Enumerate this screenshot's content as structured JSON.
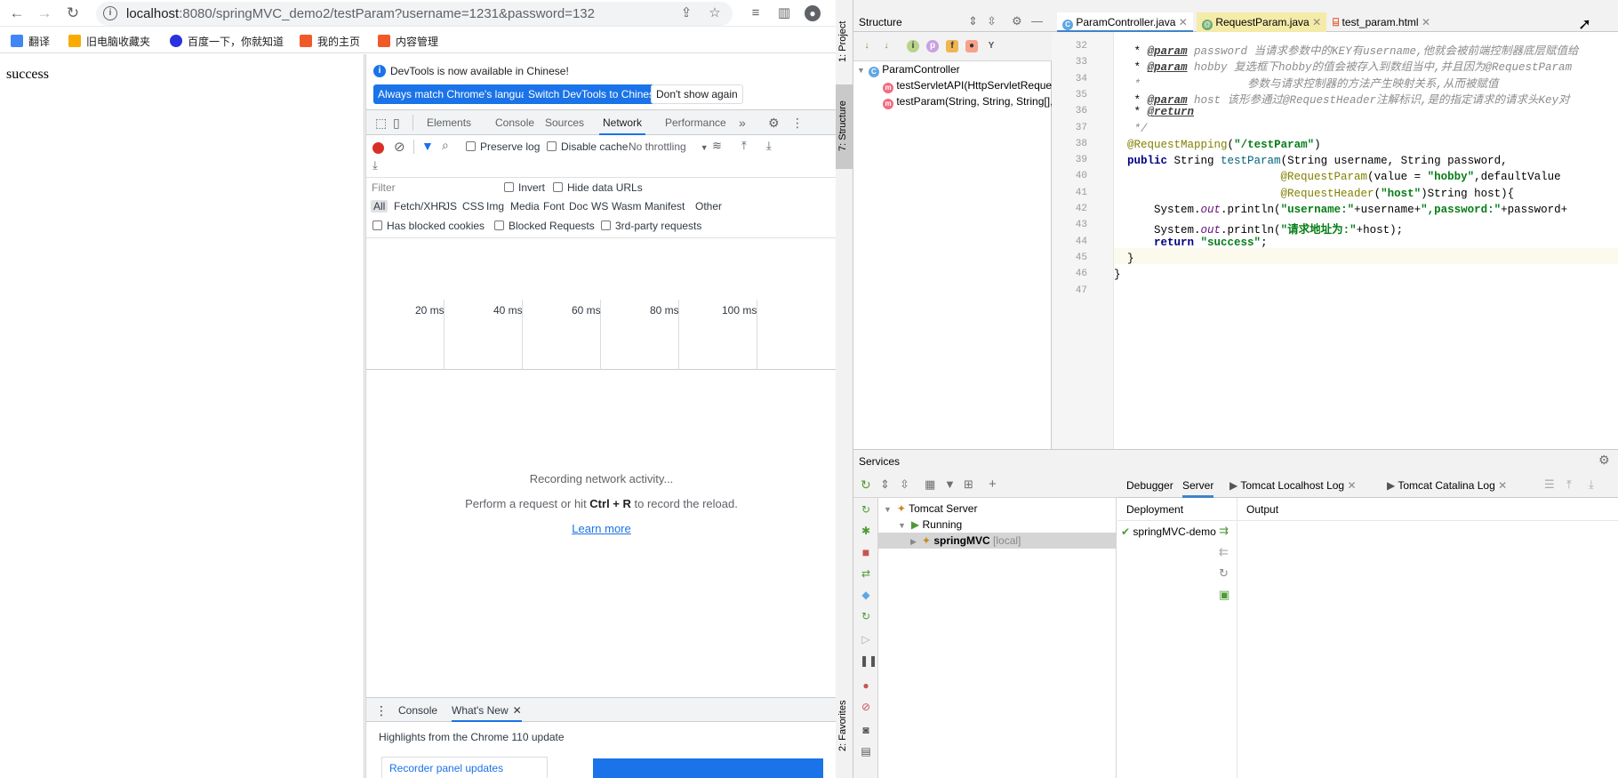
{
  "browser": {
    "url_host": "localhost",
    "url_rest": ":8080/springMVC_demo2/testParam?username=1231&password=132",
    "bookmarks": [
      "翻译",
      "旧电脑收藏夹",
      "百度一下，你就知道",
      "我的主页",
      "内容管理"
    ],
    "page_text": "success"
  },
  "devtools": {
    "banner_text": "DevTools is now available in Chinese!",
    "btn_match": "Always match Chrome's language",
    "btn_switch": "Switch DevTools to Chinese",
    "btn_dont": "Don't show again",
    "tabs": [
      "Elements",
      "Console",
      "Sources",
      "Network",
      "Performance"
    ],
    "preserve_log": "Preserve log",
    "disable_cache": "Disable cache",
    "throttling": "No throttling",
    "filter_placeholder": "Filter",
    "invert": "Invert",
    "hide_data_urls": "Hide data URLs",
    "types": [
      "All",
      "Fetch/XHR",
      "JS",
      "CSS",
      "Img",
      "Media",
      "Font",
      "Doc",
      "WS",
      "Wasm",
      "Manifest",
      "Other"
    ],
    "has_blocked_cookies": "Has blocked cookies",
    "blocked_requests": "Blocked Requests",
    "third_party": "3rd-party requests",
    "timeline": [
      "20 ms",
      "40 ms",
      "60 ms",
      "80 ms",
      "100 ms"
    ],
    "recording": "Recording network activity...",
    "perform_prefix": "Perform a request or hit ",
    "perform_key": "Ctrl + R",
    "perform_suffix": " to record the reload.",
    "learn_more": "Learn more",
    "drawer_tabs": [
      "Console",
      "What's New"
    ],
    "highlights": "Highlights from the Chrome 110 update",
    "recorder": "Recorder panel updates"
  },
  "ide": {
    "left_strip": [
      "1: Project",
      "7: Structure",
      "2: Favorites"
    ],
    "structure_title": "Structure",
    "tree": {
      "class": "ParamController",
      "m1": "testServletAPI(HttpServletRequest)",
      "m2": "testParam(String, String, String[], String)"
    },
    "tabs": [
      "ParamController.java",
      "RequestParam.java",
      "test_param.html"
    ],
    "code": [
      {
        "n": "32",
        "html": "   * <span class='c-tag'>@param</span><span class='c-doc'> password 当请求参数中的KEY有username,他就会被前端控制器底层赋值给</span>"
      },
      {
        "n": "33",
        "html": "   * <span class='c-tag'>@param</span><span class='c-doc'> hobby 复选框下hobby的值会被存入到数组当中,并且因为@RequestParam</span>"
      },
      {
        "n": "34",
        "html": "<span class='c-doc'>   *                参数与请求控制器的方法产生映射关系,从而被赋值</span>"
      },
      {
        "n": "35",
        "html": "   * <span class='c-tag'>@param</span><span class='c-doc'> host 该形参通过@RequestHeader注解标识,是的指定请求的请求头Key对</span>"
      },
      {
        "n": "36",
        "html": "   * <span class='c-tag'>@return</span>"
      },
      {
        "n": "37",
        "html": "<span class='c-doc'>   */</span>"
      },
      {
        "n": "38",
        "html": "  <span class='c-ann'>@RequestMapping</span>(<span class='c-str'>\"/testParam\"</span>)"
      },
      {
        "n": "39",
        "html": "  <span class='c-kw'>public</span> String <span class='c-fn'>testParam</span>(String username, String password,"
      },
      {
        "n": "40",
        "html": "                         <span class='c-ann'>@RequestParam</span>(value = <span class='c-str'>\"hobby\"</span>,defaultValue"
      },
      {
        "n": "41",
        "html": "                         <span class='c-ann'>@RequestHeader</span>(<span class='c-str'>\"host\"</span>)String host){"
      },
      {
        "n": "42",
        "html": "      System.<span class='c-static'>out</span>.println(<span class='c-str'>\"username:\"</span>+username+<span class='c-str'>\",password:\"</span>+password+"
      },
      {
        "n": "43",
        "html": "      System.<span class='c-static'>out</span>.println(<span class='c-str'>\"请求地址为:\"</span>+host);"
      },
      {
        "n": "44",
        "html": "      <span class='c-kw'>return</span> <span class='c-str'>\"success\"</span>;"
      },
      {
        "n": "45",
        "html": "  }"
      },
      {
        "n": "46",
        "html": "}"
      },
      {
        "n": "47",
        "html": ""
      }
    ],
    "services_title": "Services",
    "svc_tabs": [
      "Debugger",
      "Server",
      "Tomcat Localhost Log",
      "Tomcat Catalina Log"
    ],
    "svc_tree": {
      "server": "Tomcat Server",
      "running": "Running",
      "app": "springMVC",
      "app_suffix": "[local]"
    },
    "deployment_label": "Deployment",
    "output_label": "Output",
    "deployment_item": "springMVC-demo"
  }
}
